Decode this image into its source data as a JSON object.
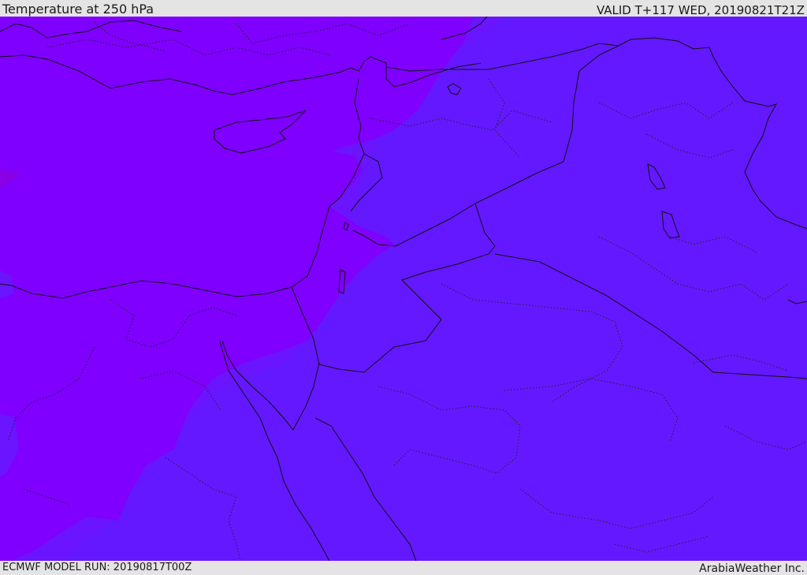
{
  "header": {
    "title": "Temperature at 250 hPa",
    "valid_time": "VALID T+117 WED, 20190821T21Z"
  },
  "footer": {
    "model_run": "ECMWF MODEL RUN: 20190817T00Z",
    "credit": "ArabiaWeather Inc."
  },
  "colors": {
    "warm_field": "#7f00ff",
    "mid_field": "#6a14ff",
    "cool_field": "#6418ff",
    "warm_spot": "#8a00e6",
    "bar_background": "#e4e4e4",
    "line": "#111111"
  }
}
